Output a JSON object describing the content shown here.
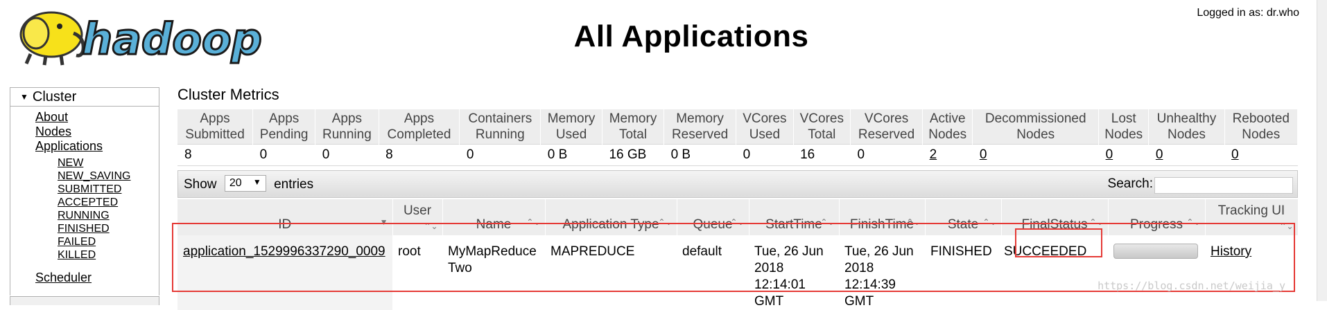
{
  "header": {
    "logo_text": "hadoop",
    "title": "All Applications",
    "logged_in": "Logged in as: dr.who"
  },
  "sidebar": {
    "section": "Cluster",
    "links": [
      "About",
      "Nodes",
      "Applications"
    ],
    "app_states": [
      "NEW",
      "NEW_SAVING",
      "SUBMITTED",
      "ACCEPTED",
      "RUNNING",
      "FINISHED",
      "FAILED",
      "KILLED"
    ],
    "scheduler": "Scheduler"
  },
  "metrics": {
    "label": "Cluster Metrics",
    "headers": [
      [
        "Apps",
        "Submitted"
      ],
      [
        "Apps",
        "Pending"
      ],
      [
        "Apps",
        "Running"
      ],
      [
        "Apps",
        "Completed"
      ],
      [
        "Containers",
        "Running"
      ],
      [
        "Memory",
        "Used"
      ],
      [
        "Memory",
        "Total"
      ],
      [
        "Memory",
        "Reserved"
      ],
      [
        "VCores",
        "Used"
      ],
      [
        "VCores",
        "Total"
      ],
      [
        "VCores",
        "Reserved"
      ],
      [
        "Active",
        "Nodes"
      ],
      [
        "Decommissioned",
        "Nodes"
      ],
      [
        "Lost",
        "Nodes"
      ],
      [
        "Unhealthy",
        "Nodes"
      ],
      [
        "Rebooted",
        "Nodes"
      ]
    ],
    "values": [
      "8",
      "0",
      "0",
      "8",
      "0",
      "0 B",
      "16 GB",
      "0 B",
      "0",
      "16",
      "0",
      "2",
      "0",
      "0",
      "0",
      "0"
    ]
  },
  "toolbar": {
    "show_label": "Show",
    "entries_value": "20",
    "entries_label": "entries",
    "search_label": "Search:"
  },
  "apps": {
    "headers": [
      "ID",
      "User",
      "Name",
      "Application Type",
      "Queue",
      "StartTime",
      "FinishTime",
      "State",
      "FinalStatus",
      "Progress",
      "Tracking UI"
    ],
    "rows": [
      {
        "id": "application_1529996337290_0009",
        "user": "root",
        "name": "MyMapReduce Two",
        "type": "MAPREDUCE",
        "queue": "default",
        "start": "Tue, 26 Jun 2018 12:14:01 GMT",
        "finish": "Tue, 26 Jun 2018 12:14:39 GMT",
        "state": "FINISHED",
        "final_status": "SUCCEEDED",
        "progress": 1.0,
        "tracking": "History"
      }
    ]
  },
  "watermark": "https://blog.csdn.net/weijia_y"
}
